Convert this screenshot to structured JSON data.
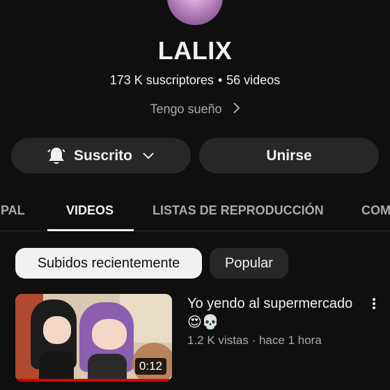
{
  "channel": {
    "name": "LALIX",
    "subscribers": "173 K suscriptores",
    "separator": "•",
    "video_count": "56 videos",
    "description": "Tengo sueño"
  },
  "actions": {
    "subscribe_label": "Suscrito",
    "join_label": "Unirse"
  },
  "tabs": [
    {
      "label": "IPAL",
      "active": false
    },
    {
      "label": "VIDEOS",
      "active": true
    },
    {
      "label": "LISTAS DE REPRODUCCIÓN",
      "active": false
    },
    {
      "label": "COM",
      "active": false
    }
  ],
  "filters": [
    {
      "label": "Subidos recientemente",
      "selected": true
    },
    {
      "label": "Popular",
      "selected": false
    }
  ],
  "videos": [
    {
      "title": "Yo yendo al supermercado😍💀",
      "meta": "1.2 K vistas · hace 1 hora",
      "duration": "0:12",
      "watched_fraction": 1.0
    }
  ],
  "icons": {
    "bell": "bell-icon",
    "caret": "chevron-down-icon",
    "more": "more-vertical-icon",
    "description_chevron": "chevron-right-icon"
  },
  "colors": {
    "background": "#0f0f0f",
    "button": "#272727",
    "progress": "#e00000",
    "secondary_text": "#aaaaaa"
  }
}
